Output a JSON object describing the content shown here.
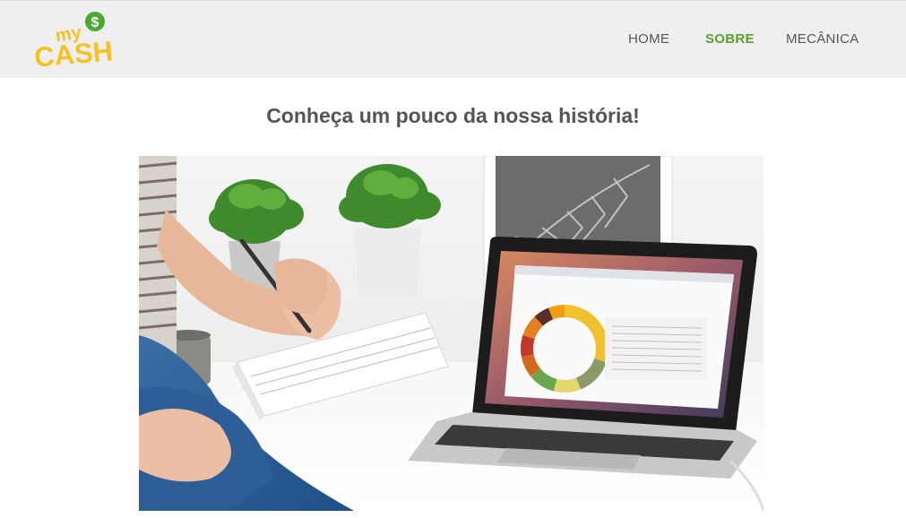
{
  "brand": {
    "logo_small": "my",
    "logo_main": "CASH",
    "logo_symbol": "$",
    "colors": {
      "yellow": "#f5c321",
      "green": "#49a830"
    }
  },
  "nav": {
    "items": [
      {
        "label": "HOME",
        "active": false
      },
      {
        "label": "SOBRE",
        "active": true
      },
      {
        "label": "MECÂNICA",
        "active": false
      }
    ],
    "active_color": "#5aa02c"
  },
  "page": {
    "title": "Conheça um pouco da nossa história!"
  },
  "hero": {
    "icon": "laptop-finance-photo",
    "donut_colors": [
      "#f2c12e",
      "#8a9a6a",
      "#e3d66d",
      "#6aa84f",
      "#d2691e",
      "#c0392b",
      "#e67e22",
      "#5a2d2d",
      "#f39c12"
    ]
  }
}
